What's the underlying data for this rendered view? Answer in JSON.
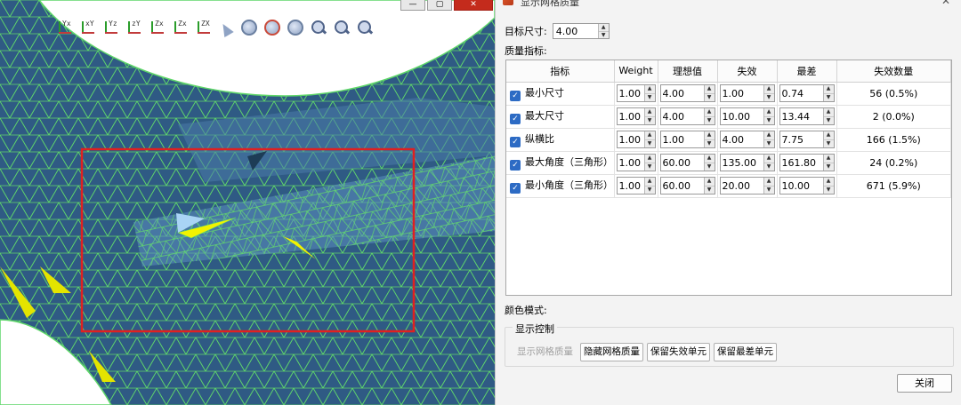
{
  "window_controls": {
    "minimize": "—",
    "maximize": "▢",
    "close": "✕"
  },
  "toolbar": {
    "buttons": [
      {
        "icon": "view-axis-yx-icon",
        "label": "Yx"
      },
      {
        "icon": "view-axis-xy-icon",
        "label": "xY"
      },
      {
        "icon": "view-axis-yz-icon",
        "label": "Yz"
      },
      {
        "icon": "view-axis-zy-icon",
        "label": "zY"
      },
      {
        "icon": "view-axis-zx-icon",
        "label": "Zx"
      },
      {
        "icon": "view-axis-xz-icon",
        "label": "Zx"
      },
      {
        "icon": "view-axis-iso-icon",
        "label": "ZX"
      }
    ]
  },
  "dialog": {
    "title": "显示网格质量",
    "close_glyph": "✕",
    "target_size_label": "目标尺寸:",
    "target_size_value": "4.00",
    "quality_label": "质量指标:",
    "columns": [
      "指标",
      "Weight",
      "理想值",
      "失效",
      "最差",
      "失效数量"
    ],
    "rows": [
      {
        "name": "最小尺寸",
        "checked": true,
        "weight": "1.00",
        "ideal": "4.00",
        "fail": "1.00",
        "worst": "0.74",
        "fail_count": "56 (0.5%)"
      },
      {
        "name": "最大尺寸",
        "checked": true,
        "weight": "1.00",
        "ideal": "4.00",
        "fail": "10.00",
        "worst": "13.44",
        "fail_count": "2 (0.0%)"
      },
      {
        "name": "纵横比",
        "checked": true,
        "weight": "1.00",
        "ideal": "1.00",
        "fail": "4.00",
        "worst": "7.75",
        "fail_count": "166 (1.5%)"
      },
      {
        "name": "最大角度（三角形）",
        "checked": true,
        "weight": "1.00",
        "ideal": "60.00",
        "fail": "135.00",
        "worst": "161.80",
        "fail_count": "24 (0.2%)"
      },
      {
        "name": "最小角度（三角形）",
        "checked": true,
        "weight": "1.00",
        "ideal": "60.00",
        "fail": "20.00",
        "worst": "10.00",
        "fail_count": "671 (5.9%)"
      }
    ],
    "color_mode_label": "颜色模式:",
    "display_control_label": "显示控制",
    "buttons": {
      "show_quality": "显示网格质量",
      "hide_quality": "隐藏网格质量",
      "keep_failed": "保留失效单元",
      "keep_worst": "保留最差单元",
      "close": "关闭"
    }
  },
  "colors": {
    "mesh_fill": "#2f5a84",
    "mesh_edge": "#5fd66a",
    "highlight_yellow": "#f2f200",
    "selection_box": "#e02020",
    "accent_check": "#2d6bc4"
  }
}
